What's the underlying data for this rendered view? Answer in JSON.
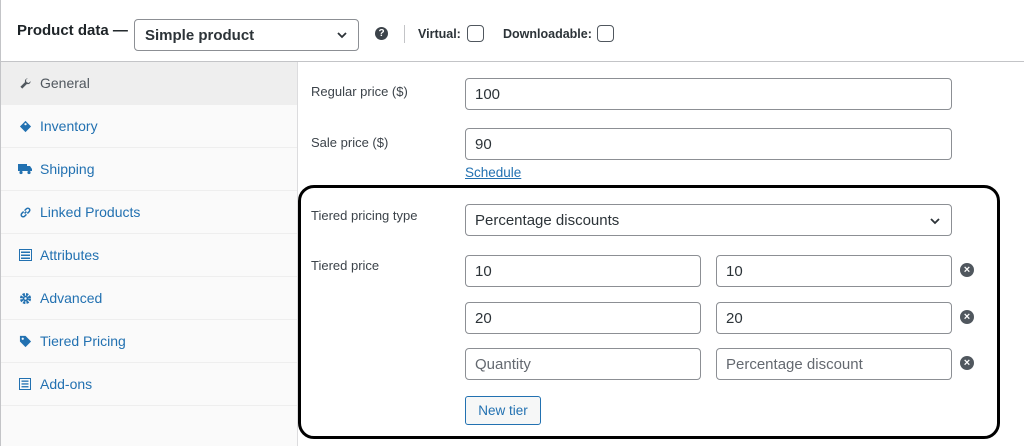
{
  "header": {
    "title": "Product data —",
    "product_type": "Simple product",
    "help_icon": "question-circle-icon",
    "virtual_label": "Virtual:",
    "downloadable_label": "Downloadable:"
  },
  "sidebar": {
    "items": [
      {
        "label": "General",
        "icon": "wrench-icon",
        "active": true
      },
      {
        "label": "Inventory",
        "icon": "tag-icon",
        "active": false
      },
      {
        "label": "Shipping",
        "icon": "truck-icon",
        "active": false
      },
      {
        "label": "Linked Products",
        "icon": "link-icon",
        "active": false
      },
      {
        "label": "Attributes",
        "icon": "list-table-icon",
        "active": false
      },
      {
        "label": "Advanced",
        "icon": "gear-icon",
        "active": false
      },
      {
        "label": "Tiered Pricing",
        "icon": "tag-icon",
        "active": false
      },
      {
        "label": "Add-ons",
        "icon": "list-icon",
        "active": false
      }
    ]
  },
  "pricing": {
    "regular_label": "Regular price ($)",
    "regular_value": "100",
    "sale_label": "Sale price ($)",
    "sale_value": "90",
    "schedule_link": "Schedule"
  },
  "tiered": {
    "type_label": "Tiered pricing type",
    "type_value": "Percentage discounts",
    "price_label": "Tiered price",
    "rows": [
      {
        "quantity": "10",
        "discount": "10"
      },
      {
        "quantity": "20",
        "discount": "20"
      }
    ],
    "quantity_placeholder": "Quantity",
    "discount_placeholder": "Percentage discount",
    "new_tier_label": "New tier"
  },
  "colors": {
    "link": "#2271b1",
    "highlight_border": "#000000"
  }
}
